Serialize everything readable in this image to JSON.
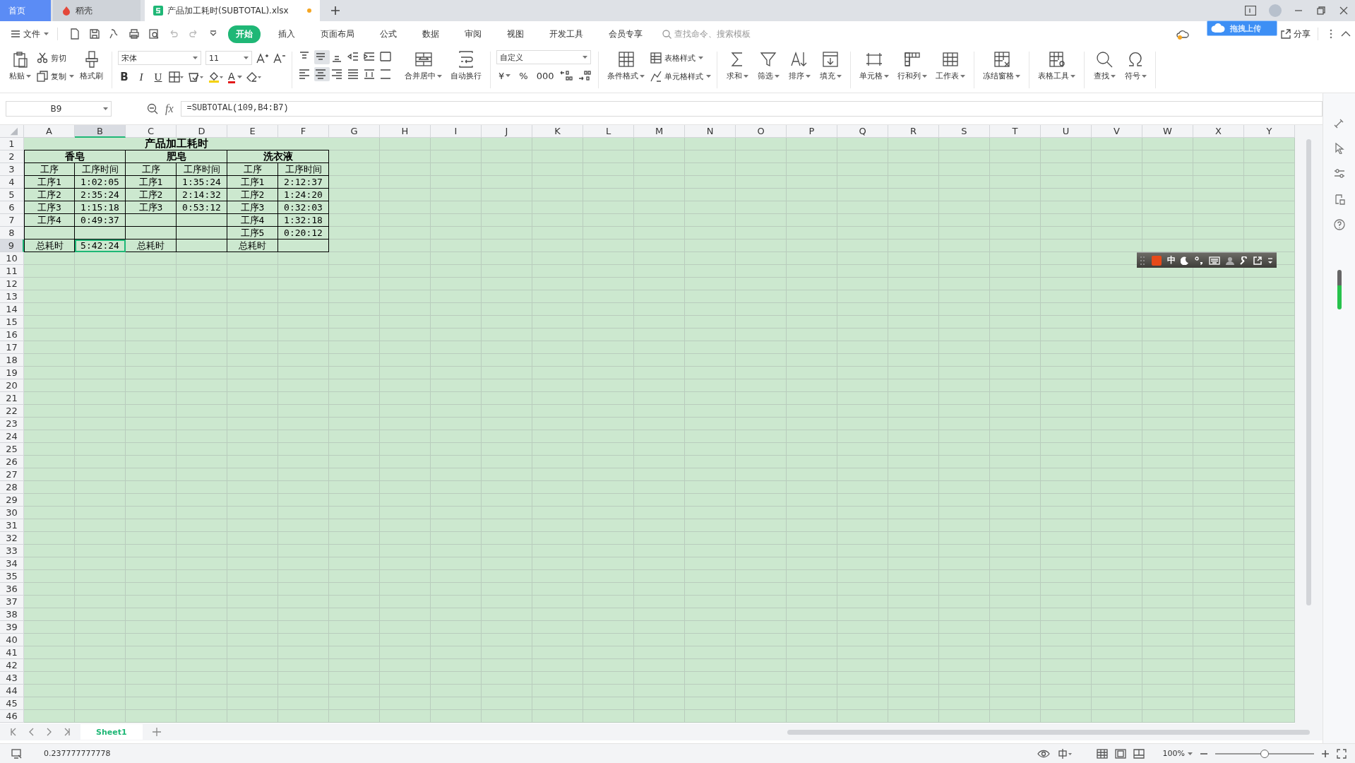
{
  "tabs": [
    {
      "label": "首页",
      "kind": "home",
      "selected": false
    },
    {
      "label": "稻壳",
      "kind": "docer",
      "selected": false
    },
    {
      "label": "产品加工耗时(SUBTOTAL).xlsx",
      "kind": "file",
      "selected": true,
      "modified": true
    }
  ],
  "menu": {
    "file": "文件",
    "items": [
      {
        "label": "开始",
        "selected": true
      },
      {
        "label": "插入",
        "selected": false
      },
      {
        "label": "页面布局",
        "selected": false
      },
      {
        "label": "公式",
        "selected": false
      },
      {
        "label": "数据",
        "selected": false
      },
      {
        "label": "审阅",
        "selected": false
      },
      {
        "label": "视图",
        "selected": false
      },
      {
        "label": "开发工具",
        "selected": false
      },
      {
        "label": "会员专享",
        "selected": false
      }
    ],
    "search": {
      "placeholder": "查找命令、搜索模板"
    },
    "share": "分享"
  },
  "upload_popup": {
    "label": "拖拽上传"
  },
  "ribbon": {
    "clipboard": [
      {
        "label": "粘贴",
        "dropdown": true
      },
      {
        "label": "剪切",
        "dropdown": false
      },
      {
        "label": "复制",
        "dropdown": true
      },
      {
        "label": "格式刷",
        "dropdown": false
      }
    ],
    "font": {
      "name": "宋体",
      "size": "11",
      "styles": [
        "B",
        "I",
        "U"
      ],
      "color_letter": "A"
    },
    "alignment": [
      {
        "selected": false
      },
      {
        "selected": true
      },
      {
        "selected": false
      },
      {
        "selected": false
      },
      {
        "selected": false
      },
      {
        "selected": false
      },
      {
        "selected": false
      },
      {
        "selected": true
      },
      {
        "selected": false
      },
      {
        "selected": false
      },
      {
        "selected": false
      },
      {
        "selected": false
      }
    ],
    "merge": [
      {
        "label": "合并居中",
        "dropdown": true
      },
      {
        "label": "自动换行",
        "dropdown": false
      }
    ],
    "number": {
      "format": "自定义",
      "symbols": [
        "¥",
        "%",
        "000"
      ]
    },
    "styles": [
      {
        "label": "条件格式",
        "dropdown": true
      },
      {
        "label": "表格样式",
        "dropdown": true
      },
      {
        "label": "单元格样式",
        "dropdown": true
      }
    ],
    "tools": [
      {
        "label": "求和",
        "dropdown": true
      },
      {
        "label": "筛选",
        "dropdown": true
      },
      {
        "label": "排序",
        "dropdown": true
      },
      {
        "label": "填充",
        "dropdown": true
      },
      {
        "label": "单元格",
        "dropdown": true
      },
      {
        "label": "行和列",
        "dropdown": true
      },
      {
        "label": "工作表",
        "dropdown": true
      },
      {
        "label": "冻结窗格",
        "dropdown": true
      },
      {
        "label": "表格工具",
        "dropdown": true
      },
      {
        "label": "查找",
        "dropdown": true
      },
      {
        "label": "符号",
        "dropdown": true
      }
    ]
  },
  "formula_bar": {
    "name_box": "B9",
    "fx": "fx",
    "formula": "=SUBTOTAL(109,B4:B7)"
  },
  "sheet": {
    "columns": [
      {
        "label": "A",
        "selected": false
      },
      {
        "label": "B",
        "selected": true
      },
      {
        "label": "C",
        "selected": false
      },
      {
        "label": "D",
        "selected": false
      },
      {
        "label": "E",
        "selected": false
      },
      {
        "label": "F",
        "selected": false
      },
      {
        "label": "G",
        "selected": false
      },
      {
        "label": "H",
        "selected": false
      },
      {
        "label": "I",
        "selected": false
      },
      {
        "label": "J",
        "selected": false
      },
      {
        "label": "K",
        "selected": false
      },
      {
        "label": "L",
        "selected": false
      },
      {
        "label": "M",
        "selected": false
      },
      {
        "label": "N",
        "selected": false
      },
      {
        "label": "O",
        "selected": false
      },
      {
        "label": "P",
        "selected": false
      },
      {
        "label": "Q",
        "selected": false
      },
      {
        "label": "R",
        "selected": false
      },
      {
        "label": "S",
        "selected": false
      },
      {
        "label": "T",
        "selected": false
      },
      {
        "label": "U",
        "selected": false
      },
      {
        "label": "V",
        "selected": false
      },
      {
        "label": "W",
        "selected": false
      },
      {
        "label": "X",
        "selected": false
      },
      {
        "label": "Y",
        "selected": false
      }
    ],
    "rows": [
      {
        "label": "1",
        "selected": false
      },
      {
        "label": "2",
        "selected": false
      },
      {
        "label": "3",
        "selected": false
      },
      {
        "label": "4",
        "selected": false
      },
      {
        "label": "5",
        "selected": false
      },
      {
        "label": "6",
        "selected": false
      },
      {
        "label": "7",
        "selected": false
      },
      {
        "label": "8",
        "selected": false
      },
      {
        "label": "9",
        "selected": true
      },
      {
        "label": "10",
        "selected": false
      },
      {
        "label": "11",
        "selected": false
      },
      {
        "label": "12",
        "selected": false
      },
      {
        "label": "13",
        "selected": false
      },
      {
        "label": "14",
        "selected": false
      },
      {
        "label": "15",
        "selected": false
      },
      {
        "label": "16",
        "selected": false
      },
      {
        "label": "17",
        "selected": false
      },
      {
        "label": "18",
        "selected": false
      },
      {
        "label": "19",
        "selected": false
      },
      {
        "label": "20",
        "selected": false
      },
      {
        "label": "21",
        "selected": false
      },
      {
        "label": "22",
        "selected": false
      },
      {
        "label": "23",
        "selected": false
      },
      {
        "label": "24",
        "selected": false
      },
      {
        "label": "25",
        "selected": false
      },
      {
        "label": "26",
        "selected": false
      },
      {
        "label": "27",
        "selected": false
      },
      {
        "label": "28",
        "selected": false
      },
      {
        "label": "29",
        "selected": false
      },
      {
        "label": "30",
        "selected": false
      },
      {
        "label": "31",
        "selected": false
      },
      {
        "label": "32",
        "selected": false
      },
      {
        "label": "33",
        "selected": false
      },
      {
        "label": "34",
        "selected": false
      },
      {
        "label": "35",
        "selected": false
      },
      {
        "label": "36",
        "selected": false
      },
      {
        "label": "37",
        "selected": false
      },
      {
        "label": "38",
        "selected": false
      },
      {
        "label": "39",
        "selected": false
      },
      {
        "label": "40",
        "selected": false
      },
      {
        "label": "41",
        "selected": false
      },
      {
        "label": "42",
        "selected": false
      },
      {
        "label": "43",
        "selected": false
      },
      {
        "label": "44",
        "selected": false
      },
      {
        "label": "45",
        "selected": false
      },
      {
        "label": "46",
        "selected": false
      }
    ],
    "table": {
      "title": "产品加工耗时",
      "groups": [
        {
          "name": "香皂",
          "header": [
            "工序",
            "工序时间"
          ],
          "rows": [
            [
              "工序1",
              "1:02:05"
            ],
            [
              "工序2",
              "2:35:24"
            ],
            [
              "工序3",
              "1:15:18"
            ],
            [
              "工序4",
              "0:49:37"
            ]
          ],
          "total_label": "总耗时",
          "total_value": "5:42:24",
          "total_selected": true
        },
        {
          "name": "肥皂",
          "header": [
            "工序",
            "工序时间"
          ],
          "rows": [
            [
              "工序1",
              "1:35:24"
            ],
            [
              "工序2",
              "2:14:32"
            ],
            [
              "工序3",
              "0:53:12"
            ]
          ],
          "total_label": "总耗时",
          "total_selected": false
        },
        {
          "name": "洗衣液",
          "header": [
            "工序",
            "工序时间"
          ],
          "rows": [
            [
              "工序1",
              "2:12:37"
            ],
            [
              "工序2",
              "1:24:20"
            ],
            [
              "工序3",
              "0:32:03"
            ],
            [
              "工序4",
              "1:32:18"
            ],
            [
              "工序5",
              "0:20:12"
            ]
          ],
          "total_label": "总耗时",
          "total_selected": false
        }
      ]
    }
  },
  "ime_toolbar": {
    "label": "中"
  },
  "sheet_tabs": [
    {
      "label": "Sheet1",
      "selected": true
    }
  ],
  "status_bar": {
    "value": "0.237777777778",
    "zoom": "100%",
    "zoom_slider": {
      "level": 0.5
    }
  }
}
